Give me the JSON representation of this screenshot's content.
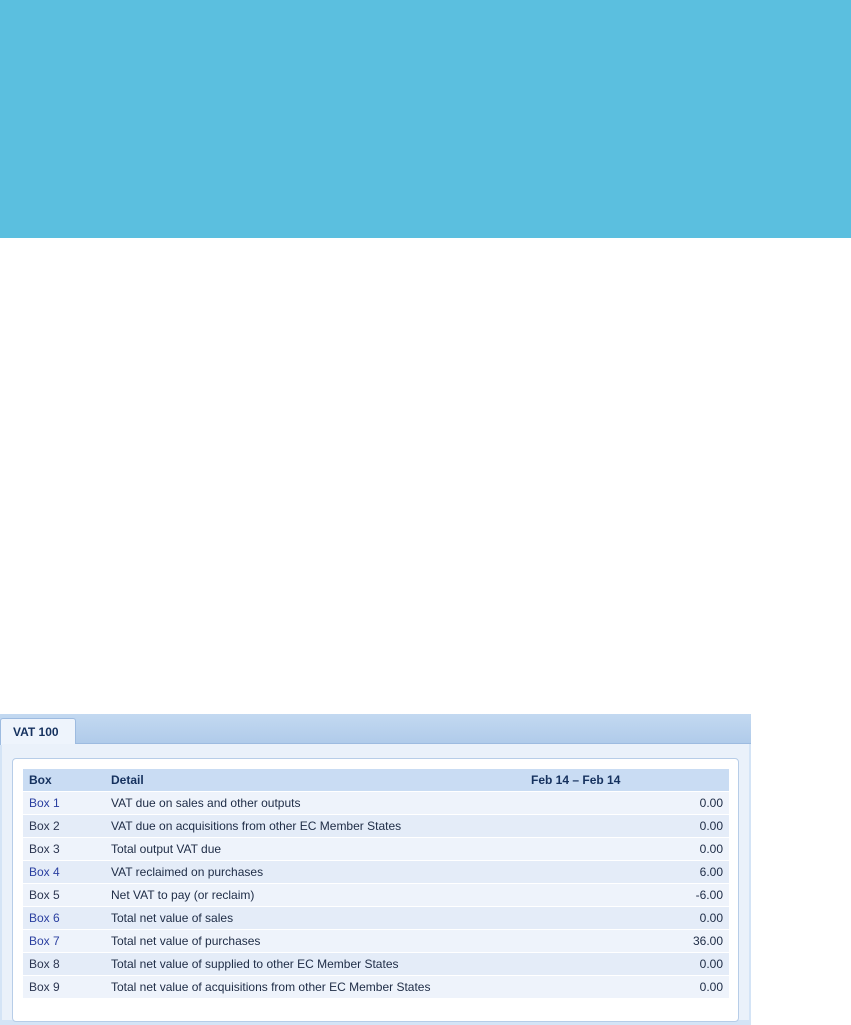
{
  "vat_panel": {
    "tab_label": "VAT 100",
    "columns": {
      "box": "Box",
      "detail": "Detail",
      "period": "Feb 14 – Feb 14"
    },
    "rows": [
      {
        "box": "Box 1",
        "detail": "VAT due on sales and other outputs",
        "amount": "0.00",
        "link": true
      },
      {
        "box": "Box 2",
        "detail": "VAT due on acquisitions from other EC Member States",
        "amount": "0.00",
        "link": false
      },
      {
        "box": "Box 3",
        "detail": "Total output VAT due",
        "amount": "0.00",
        "link": false
      },
      {
        "box": "Box 4",
        "detail": "VAT reclaimed on purchases",
        "amount": "6.00",
        "link": true
      },
      {
        "box": "Box 5",
        "detail": "Net VAT to pay (or reclaim)",
        "amount": "-6.00",
        "link": false
      },
      {
        "box": "Box 6",
        "detail": "Total net value of sales",
        "amount": "0.00",
        "link": true
      },
      {
        "box": "Box 7",
        "detail": "Total net value of purchases",
        "amount": "36.00",
        "link": true
      },
      {
        "box": "Box 8",
        "detail": "Total net value of supplied to other EC Member States",
        "amount": "0.00",
        "link": false
      },
      {
        "box": "Box 9",
        "detail": "Total net value of acquisitions from other EC Member States",
        "amount": "0.00",
        "link": false
      }
    ]
  },
  "colors": {
    "banner": "#5bbfdf",
    "link": "#2a3fa0",
    "header_bg": "#c9dcf3"
  }
}
